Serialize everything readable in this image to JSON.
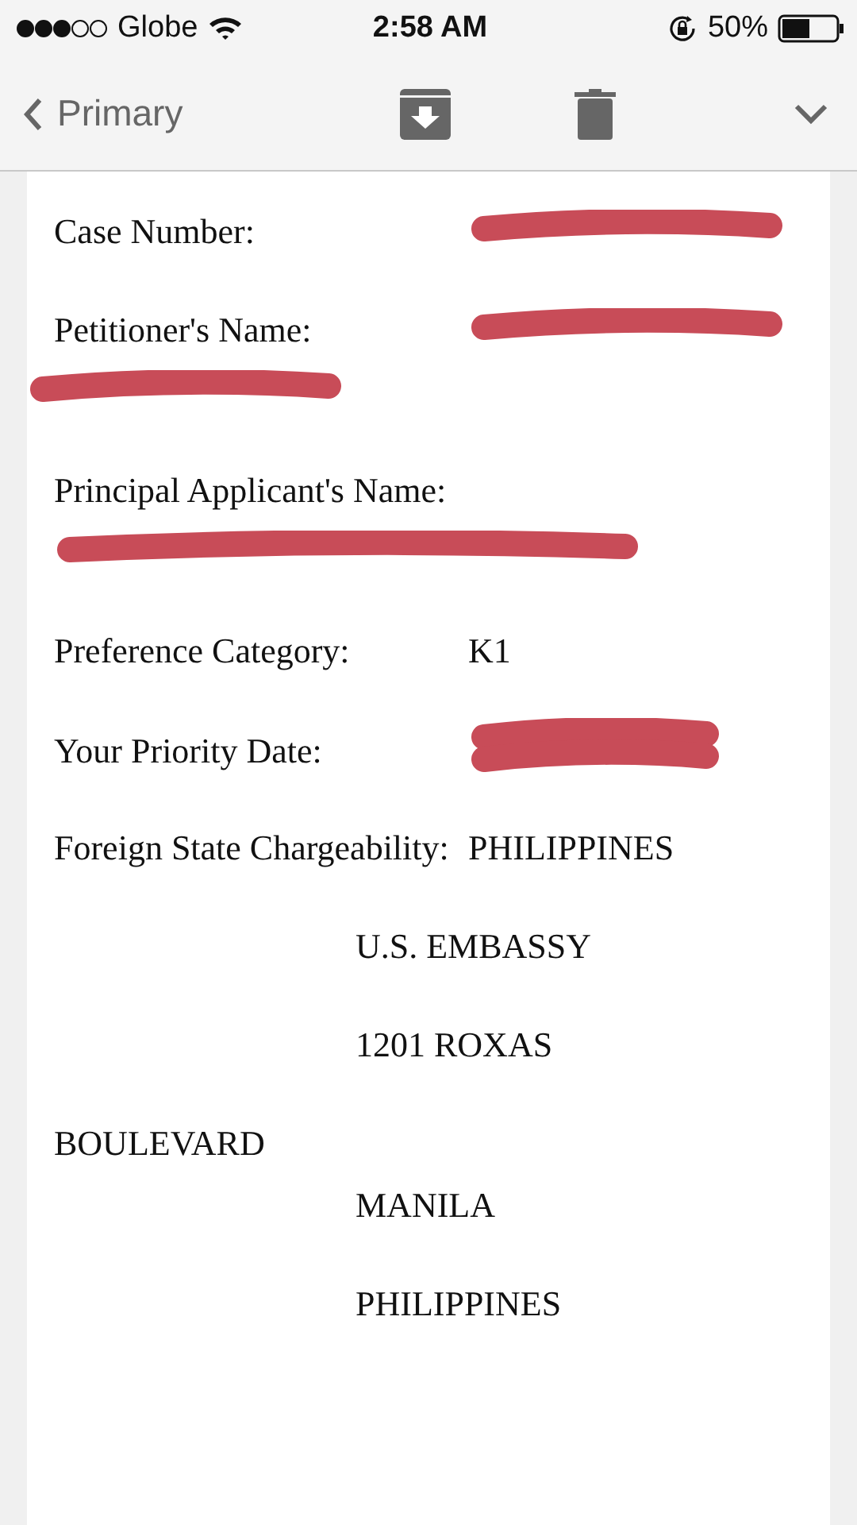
{
  "status_bar": {
    "carrier": "Globe",
    "time": "2:58 AM",
    "battery": "50%"
  },
  "nav": {
    "back_label": "Primary"
  },
  "fields": [
    {
      "kind": "redacted",
      "label": "Case Number:"
    },
    {
      "kind": "redacted_wrap",
      "label": "Petitioner's Name:"
    },
    {
      "kind": "redacted_below",
      "label": "Principal Applicant's Name:"
    },
    {
      "kind": "text",
      "label": "Preference Category:",
      "value": "K1"
    },
    {
      "kind": "redacted_double",
      "label": "Your Priority Date:"
    },
    {
      "kind": "text",
      "label": "Foreign State Chargeability:",
      "value": "PHILIPPINES"
    }
  ],
  "address_lines": [
    {
      "text": "U.S. EMBASSY",
      "indent": true
    },
    {
      "text": "1201 ROXAS",
      "indent": true
    },
    {
      "text": "BOULEVARD",
      "indent": false
    },
    {
      "text": "MANILA",
      "indent": true
    },
    {
      "text": "PHILIPPINES",
      "indent": true
    }
  ]
}
